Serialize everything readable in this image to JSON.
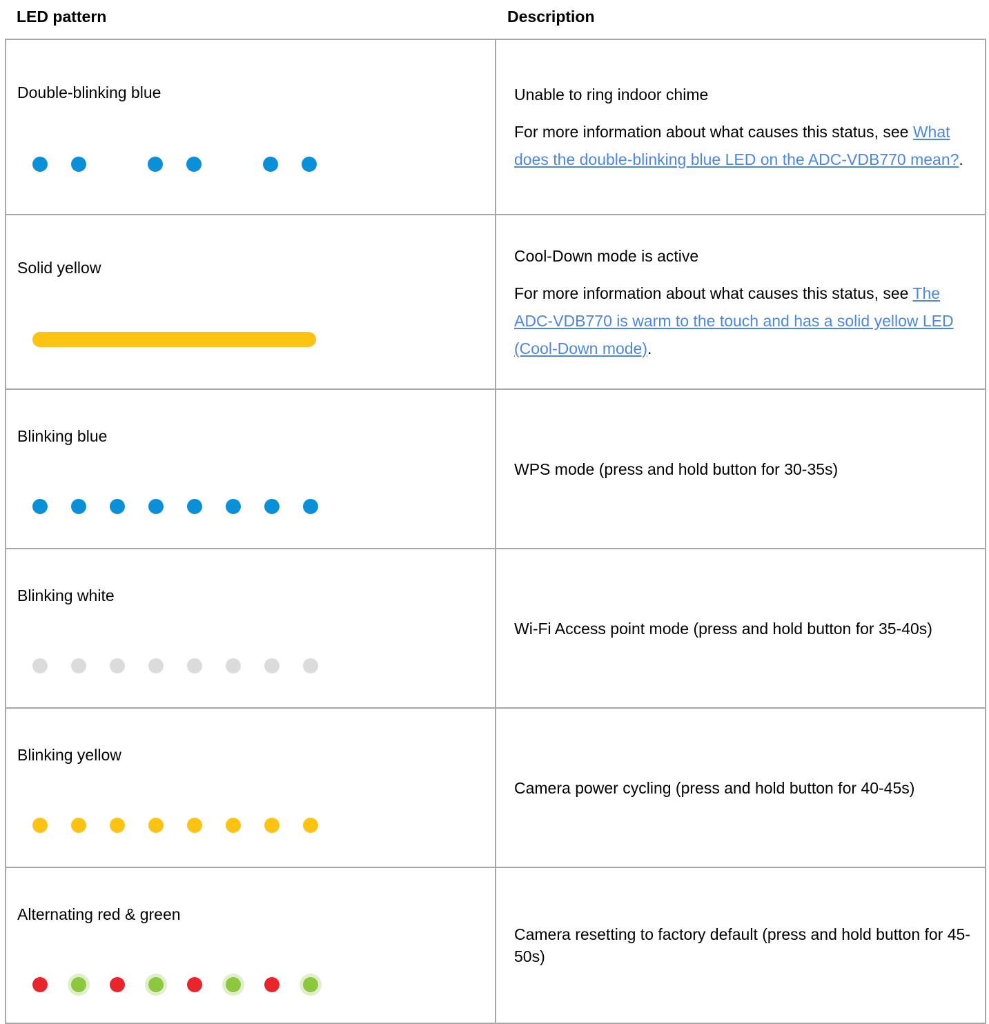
{
  "header": {
    "led_pattern": "LED pattern",
    "description": "Description"
  },
  "colors": {
    "blue": "#0a90d8",
    "yellow": "#fcc214",
    "white": "#dbdbdb",
    "red": "#e8252a",
    "green": "#8dc63f",
    "border": "#a6a6a6",
    "link": "#4a86e8"
  },
  "rows": [
    {
      "label": "Double-blinking blue",
      "pattern": {
        "type": "dots",
        "colors": [
          "blue",
          "blue",
          "blue",
          "blue",
          "blue",
          "blue"
        ],
        "grouping": "pairs"
      },
      "title": "Unable to ring indoor chime",
      "info_prefix": "For more information about what causes this status, see ",
      "link_text": "What does the double-blinking blue LED on the ADC-VDB770 mean?",
      "info_suffix": "."
    },
    {
      "label": "Solid yellow",
      "pattern": {
        "type": "bar",
        "colors": [
          "yellow"
        ]
      },
      "title": "Cool-Down mode is active",
      "info_prefix": "For more information about what causes this status, see ",
      "link_text": "The ADC-VDB770 is warm to the touch and has a solid yellow LED (Cool-Down mode)",
      "info_suffix": "."
    },
    {
      "label": "Blinking blue",
      "pattern": {
        "type": "dots",
        "colors": [
          "blue",
          "blue",
          "blue",
          "blue",
          "blue",
          "blue",
          "blue",
          "blue"
        ]
      },
      "description": "WPS mode (press and hold button for 30-35s)"
    },
    {
      "label": "Blinking white",
      "pattern": {
        "type": "dots",
        "colors": [
          "white",
          "white",
          "white",
          "white",
          "white",
          "white",
          "white",
          "white"
        ]
      },
      "description": "Wi-Fi Access point mode (press and hold button for 35-40s)"
    },
    {
      "label": "Blinking yellow",
      "pattern": {
        "type": "dots",
        "colors": [
          "yellow",
          "yellow",
          "yellow",
          "yellow",
          "yellow",
          "yellow",
          "yellow",
          "yellow"
        ]
      },
      "description": "Camera power cycling (press and hold button for 40-45s)"
    },
    {
      "label": "Alternating red & green",
      "pattern": {
        "type": "dots",
        "colors": [
          "red",
          "green",
          "red",
          "green",
          "red",
          "green",
          "red",
          "green"
        ]
      },
      "description": "Camera resetting to factory default (press and hold button for 45-50s)"
    }
  ]
}
